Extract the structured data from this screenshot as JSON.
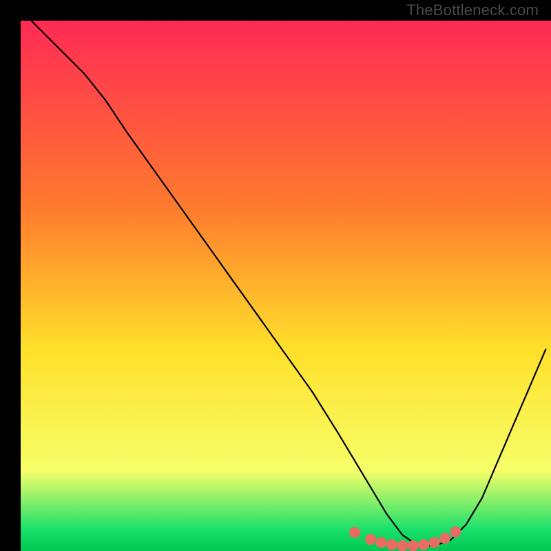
{
  "watermark": "TheBottleneck.com",
  "chart_data": {
    "type": "line",
    "title": "",
    "xlabel": "",
    "ylabel": "",
    "xlim": [
      0,
      100
    ],
    "ylim": [
      0,
      100
    ],
    "grid": false,
    "legend": false,
    "background_gradient": {
      "top": "#ff2a55",
      "upper_mid": "#ff7a2e",
      "mid": "#ffe02a",
      "lower_mid": "#f6ff6a",
      "green_band": "#19e06a",
      "bottom": "#00c853"
    },
    "series": [
      {
        "name": "bottleneck-curve",
        "color": "#000000",
        "stroke_width": 2.2,
        "x": [
          2,
          5,
          8,
          12,
          16,
          20,
          25,
          30,
          35,
          40,
          45,
          50,
          55,
          60,
          63,
          66,
          69,
          72,
          75,
          78,
          81,
          84,
          87,
          90,
          93,
          96,
          99
        ],
        "y": [
          100,
          97,
          94,
          90,
          85,
          79,
          72,
          65,
          58,
          51,
          44,
          37,
          30,
          22,
          17,
          12,
          7,
          3,
          1,
          1,
          2,
          5,
          10,
          17,
          24,
          31,
          38
        ]
      }
    ],
    "markers": {
      "name": "highlight-dots",
      "color": "#e86b64",
      "radius": 8,
      "x": [
        63,
        66,
        68,
        70,
        72,
        74,
        76,
        78,
        80,
        82
      ],
      "y": [
        3.5,
        2.2,
        1.6,
        1.2,
        1.0,
        1.0,
        1.2,
        1.6,
        2.4,
        3.6
      ]
    }
  }
}
